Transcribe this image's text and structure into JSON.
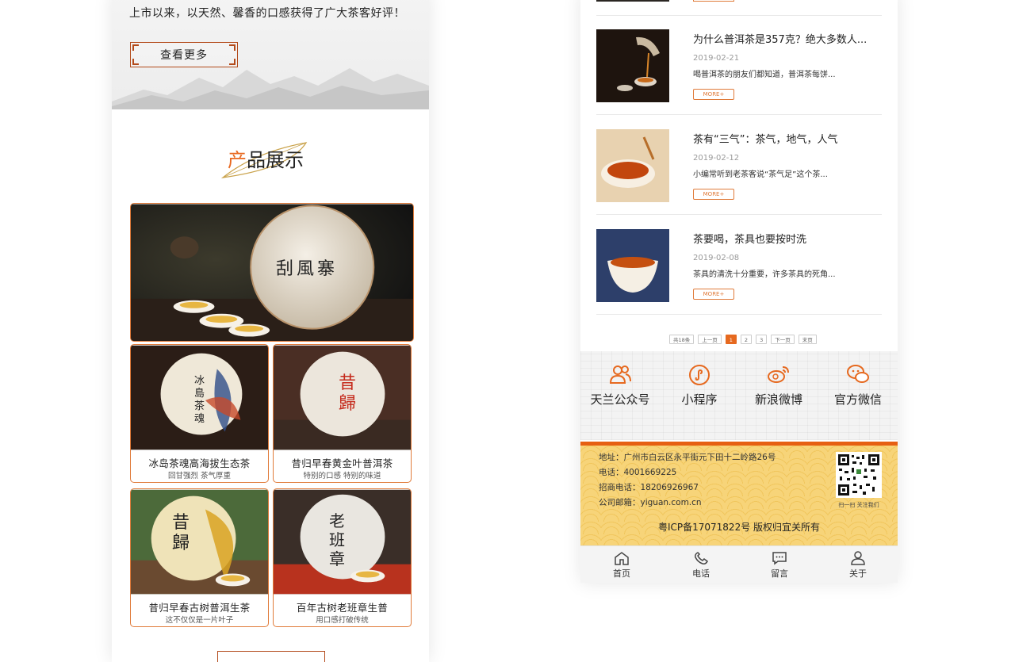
{
  "left": {
    "intro_text": "上市以来，以天然、馨香的口感获得了广大茶客好评！",
    "more_button": "查看更多",
    "section_title_first": "产",
    "section_title_rest": "品展示",
    "featured_cake_title": "刮風寨",
    "products": [
      {
        "name": "冰岛茶魂高海拔生态茶",
        "desc": "回甘强烈 茶气厚重",
        "cake": "冰島茶魂"
      },
      {
        "name": "昔归早春黄金叶普洱茶",
        "desc": "特别的口感 特别的味道",
        "cake": "昔歸"
      },
      {
        "name": "昔归早春古树普洱生茶",
        "desc": "这不仅仅是一片叶子",
        "cake": "昔歸"
      },
      {
        "name": "百年古树老班章生普",
        "desc": "用口感打破传统",
        "cake": "老班章"
      }
    ]
  },
  "right": {
    "news": [
      {
        "title": "为什么普洱茶是357克？绝大多数人...",
        "date": "2019-02-21",
        "summary": "喝普洱茶的朋友们都知道，普洱茶每饼...",
        "more": "MORE+"
      },
      {
        "title": "茶有“三气”：茶气，地气，人气",
        "date": "2019-02-12",
        "summary": "小编常听到老茶客说“茶气足”这个茶...",
        "more": "MORE+"
      },
      {
        "title": "茶要喝，茶具也要按时洗",
        "date": "2019-02-08",
        "summary": "茶具的清洗十分重要，许多茶具的死角...",
        "more": "MORE+"
      }
    ],
    "pagination": {
      "total": "共18条",
      "prev": "上一页",
      "pages": [
        "1",
        "2",
        "3"
      ],
      "next": "下一页",
      "last": "末页",
      "current": "1"
    },
    "social": [
      "天兰公众号",
      "小程序",
      "新浪微博",
      "官方微信"
    ],
    "footer": {
      "address": "地址：广州市白云区永平街元下田十二岭路26号",
      "phone": "电话：4001669225",
      "invest_phone": "招商电话：18206926967",
      "email": "公司邮箱：yiguan.com.cn",
      "qr_caption": "扫一扫 关注我们",
      "icp": "粤ICP备17071822号 版权归宜关所有"
    },
    "tabbar": [
      "首页",
      "电话",
      "留言",
      "关于"
    ]
  },
  "colors": {
    "accent": "#e6691f",
    "footer_bg": "#f7d479",
    "card_border": "#e07b3a"
  }
}
